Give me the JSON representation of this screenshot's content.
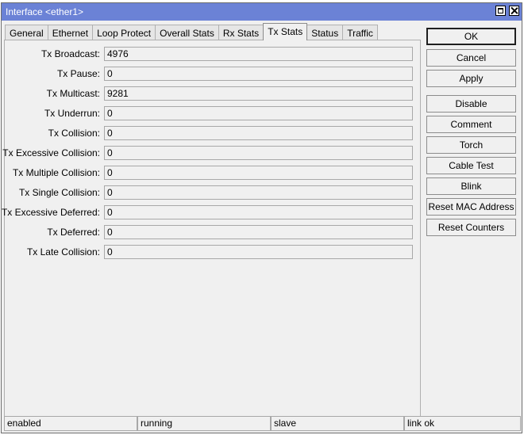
{
  "window": {
    "title": "Interface <ether1>"
  },
  "tabs": [
    {
      "label": "General"
    },
    {
      "label": "Ethernet"
    },
    {
      "label": "Loop Protect"
    },
    {
      "label": "Overall Stats"
    },
    {
      "label": "Rx Stats"
    },
    {
      "label": "Tx Stats",
      "active": true
    },
    {
      "label": "Status"
    },
    {
      "label": "Traffic"
    }
  ],
  "fields": [
    {
      "label": "Tx Broadcast:",
      "value": "4976"
    },
    {
      "label": "Tx Pause:",
      "value": "0"
    },
    {
      "label": "Tx Multicast:",
      "value": "9281"
    },
    {
      "label": "Tx Underrun:",
      "value": "0"
    },
    {
      "label": "Tx Collision:",
      "value": "0"
    },
    {
      "label": "Tx Excessive Collision:",
      "value": "0"
    },
    {
      "label": "Tx Multiple Collision:",
      "value": "0"
    },
    {
      "label": "Tx Single Collision:",
      "value": "0"
    },
    {
      "label": "Tx Excessive Deferred:",
      "value": "0"
    },
    {
      "label": "Tx Deferred:",
      "value": "0"
    },
    {
      "label": "Tx Late Collision:",
      "value": "0"
    }
  ],
  "buttons": {
    "ok": "OK",
    "cancel": "Cancel",
    "apply": "Apply",
    "disable": "Disable",
    "comment": "Comment",
    "torch": "Torch",
    "cable_test": "Cable Test",
    "blink": "Blink",
    "reset_mac": "Reset MAC Address",
    "reset_counters": "Reset Counters"
  },
  "status": [
    "enabled",
    "running",
    "slave",
    "link ok"
  ]
}
